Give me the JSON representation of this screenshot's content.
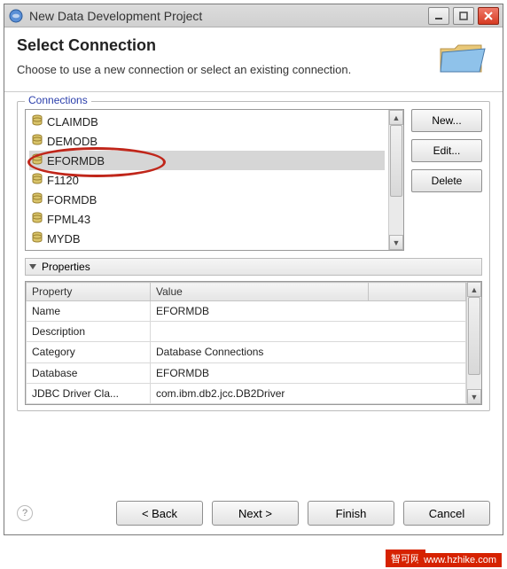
{
  "window": {
    "title": "New Data Development Project"
  },
  "header": {
    "title": "Select Connection",
    "description": "Choose to use a new connection or select an existing connection."
  },
  "fieldset": {
    "legend": "Connections"
  },
  "connections": {
    "items": [
      {
        "label": "CLAIMDB"
      },
      {
        "label": "DEMODB"
      },
      {
        "label": "EFORMDB"
      },
      {
        "label": "F1120"
      },
      {
        "label": "FORMDB"
      },
      {
        "label": "FPML43"
      },
      {
        "label": "MYDB"
      }
    ],
    "selected_index": 2
  },
  "side_buttons": {
    "new_label": "New...",
    "edit_label": "Edit...",
    "delete_label": "Delete"
  },
  "properties": {
    "section_label": "Properties",
    "columns": {
      "key": "Property",
      "value": "Value"
    },
    "rows": [
      {
        "key": "Name",
        "value": "EFORMDB"
      },
      {
        "key": "Description",
        "value": ""
      },
      {
        "key": "Category",
        "value": "Database Connections"
      },
      {
        "key": "Database",
        "value": "EFORMDB"
      },
      {
        "key": "JDBC Driver Cla...",
        "value": "com.ibm.db2.jcc.DB2Driver"
      }
    ]
  },
  "wizard_buttons": {
    "back": "< Back",
    "next": "Next >",
    "finish": "Finish",
    "cancel": "Cancel"
  },
  "watermark": {
    "left": "智可网",
    "right": "www.hzhike.com"
  }
}
